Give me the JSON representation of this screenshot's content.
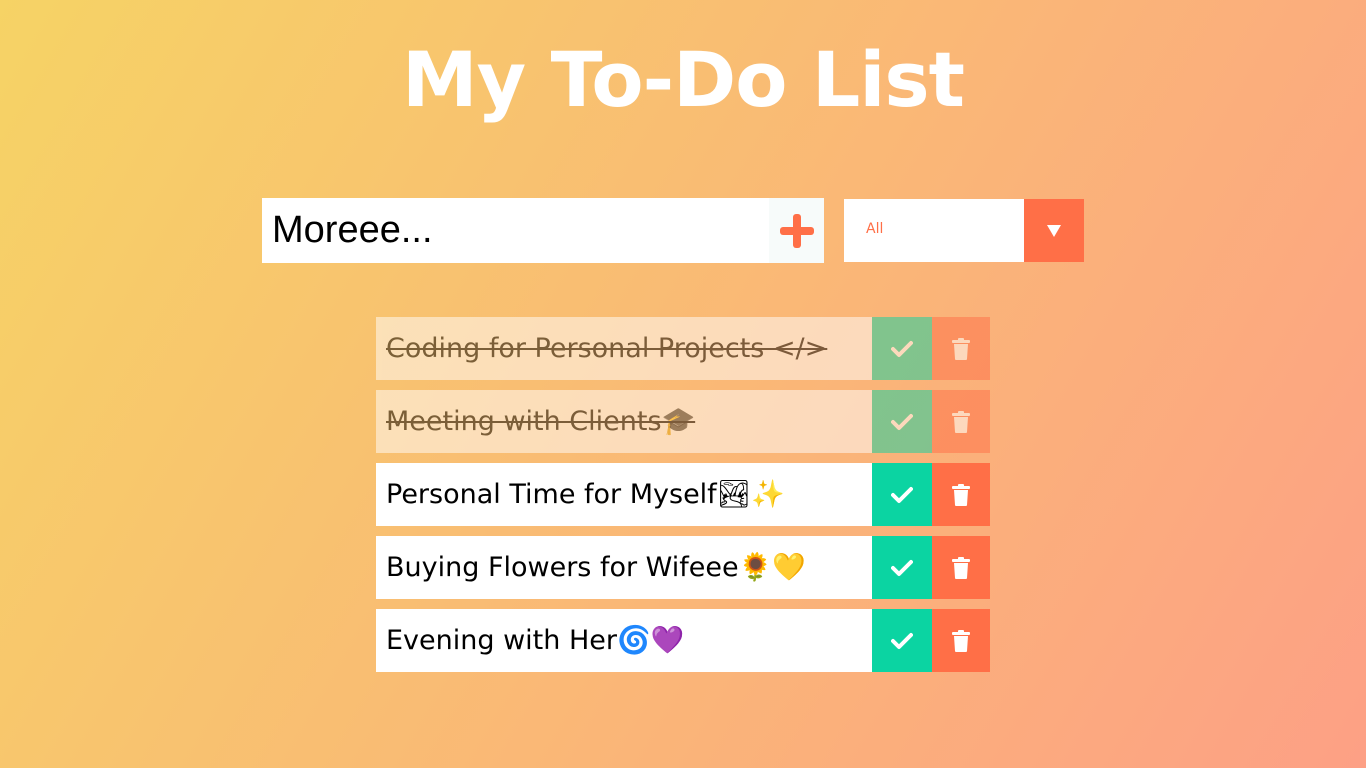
{
  "header": {
    "title": "My To-Do List"
  },
  "form": {
    "input_value": "Moreee...",
    "add_icon": "plus-icon",
    "filter_selected": "All",
    "filter_icon": "caret-down-icon"
  },
  "todos": [
    {
      "text": "Coding for Personal Projects </>",
      "completed": true
    },
    {
      "text": "Meeting with Clients🎓",
      "completed": true
    },
    {
      "text": "Personal Time for Myself🏞✨",
      "completed": false
    },
    {
      "text": "Buying Flowers for Wifeee🌻💛",
      "completed": false
    },
    {
      "text": "Evening with Her🌀💜",
      "completed": false
    }
  ],
  "icons": {
    "complete": "check-icon",
    "delete": "trash-icon"
  },
  "colors": {
    "background_start": "#f6d365",
    "background_end": "#fda085",
    "complete_button": "#0bd4a2",
    "delete_button": "#ff6f47",
    "accent": "#ff6f47"
  }
}
